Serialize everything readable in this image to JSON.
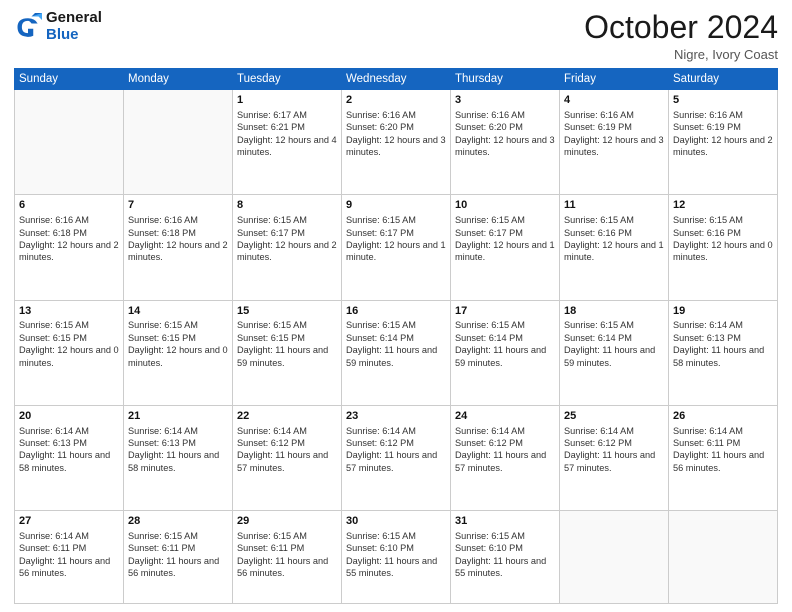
{
  "logo": {
    "line1": "General",
    "line2": "Blue"
  },
  "title": "October 2024",
  "subtitle": "Nigre, Ivory Coast",
  "days_header": [
    "Sunday",
    "Monday",
    "Tuesday",
    "Wednesday",
    "Thursday",
    "Friday",
    "Saturday"
  ],
  "weeks": [
    [
      {
        "num": "",
        "info": ""
      },
      {
        "num": "",
        "info": ""
      },
      {
        "num": "1",
        "info": "Sunrise: 6:17 AM\nSunset: 6:21 PM\nDaylight: 12 hours and 4 minutes."
      },
      {
        "num": "2",
        "info": "Sunrise: 6:16 AM\nSunset: 6:20 PM\nDaylight: 12 hours and 3 minutes."
      },
      {
        "num": "3",
        "info": "Sunrise: 6:16 AM\nSunset: 6:20 PM\nDaylight: 12 hours and 3 minutes."
      },
      {
        "num": "4",
        "info": "Sunrise: 6:16 AM\nSunset: 6:19 PM\nDaylight: 12 hours and 3 minutes."
      },
      {
        "num": "5",
        "info": "Sunrise: 6:16 AM\nSunset: 6:19 PM\nDaylight: 12 hours and 2 minutes."
      }
    ],
    [
      {
        "num": "6",
        "info": "Sunrise: 6:16 AM\nSunset: 6:18 PM\nDaylight: 12 hours and 2 minutes."
      },
      {
        "num": "7",
        "info": "Sunrise: 6:16 AM\nSunset: 6:18 PM\nDaylight: 12 hours and 2 minutes."
      },
      {
        "num": "8",
        "info": "Sunrise: 6:15 AM\nSunset: 6:17 PM\nDaylight: 12 hours and 2 minutes."
      },
      {
        "num": "9",
        "info": "Sunrise: 6:15 AM\nSunset: 6:17 PM\nDaylight: 12 hours and 1 minute."
      },
      {
        "num": "10",
        "info": "Sunrise: 6:15 AM\nSunset: 6:17 PM\nDaylight: 12 hours and 1 minute."
      },
      {
        "num": "11",
        "info": "Sunrise: 6:15 AM\nSunset: 6:16 PM\nDaylight: 12 hours and 1 minute."
      },
      {
        "num": "12",
        "info": "Sunrise: 6:15 AM\nSunset: 6:16 PM\nDaylight: 12 hours and 0 minutes."
      }
    ],
    [
      {
        "num": "13",
        "info": "Sunrise: 6:15 AM\nSunset: 6:15 PM\nDaylight: 12 hours and 0 minutes."
      },
      {
        "num": "14",
        "info": "Sunrise: 6:15 AM\nSunset: 6:15 PM\nDaylight: 12 hours and 0 minutes."
      },
      {
        "num": "15",
        "info": "Sunrise: 6:15 AM\nSunset: 6:15 PM\nDaylight: 11 hours and 59 minutes."
      },
      {
        "num": "16",
        "info": "Sunrise: 6:15 AM\nSunset: 6:14 PM\nDaylight: 11 hours and 59 minutes."
      },
      {
        "num": "17",
        "info": "Sunrise: 6:15 AM\nSunset: 6:14 PM\nDaylight: 11 hours and 59 minutes."
      },
      {
        "num": "18",
        "info": "Sunrise: 6:15 AM\nSunset: 6:14 PM\nDaylight: 11 hours and 59 minutes."
      },
      {
        "num": "19",
        "info": "Sunrise: 6:14 AM\nSunset: 6:13 PM\nDaylight: 11 hours and 58 minutes."
      }
    ],
    [
      {
        "num": "20",
        "info": "Sunrise: 6:14 AM\nSunset: 6:13 PM\nDaylight: 11 hours and 58 minutes."
      },
      {
        "num": "21",
        "info": "Sunrise: 6:14 AM\nSunset: 6:13 PM\nDaylight: 11 hours and 58 minutes."
      },
      {
        "num": "22",
        "info": "Sunrise: 6:14 AM\nSunset: 6:12 PM\nDaylight: 11 hours and 57 minutes."
      },
      {
        "num": "23",
        "info": "Sunrise: 6:14 AM\nSunset: 6:12 PM\nDaylight: 11 hours and 57 minutes."
      },
      {
        "num": "24",
        "info": "Sunrise: 6:14 AM\nSunset: 6:12 PM\nDaylight: 11 hours and 57 minutes."
      },
      {
        "num": "25",
        "info": "Sunrise: 6:14 AM\nSunset: 6:12 PM\nDaylight: 11 hours and 57 minutes."
      },
      {
        "num": "26",
        "info": "Sunrise: 6:14 AM\nSunset: 6:11 PM\nDaylight: 11 hours and 56 minutes."
      }
    ],
    [
      {
        "num": "27",
        "info": "Sunrise: 6:14 AM\nSunset: 6:11 PM\nDaylight: 11 hours and 56 minutes."
      },
      {
        "num": "28",
        "info": "Sunrise: 6:15 AM\nSunset: 6:11 PM\nDaylight: 11 hours and 56 minutes."
      },
      {
        "num": "29",
        "info": "Sunrise: 6:15 AM\nSunset: 6:11 PM\nDaylight: 11 hours and 56 minutes."
      },
      {
        "num": "30",
        "info": "Sunrise: 6:15 AM\nSunset: 6:10 PM\nDaylight: 11 hours and 55 minutes."
      },
      {
        "num": "31",
        "info": "Sunrise: 6:15 AM\nSunset: 6:10 PM\nDaylight: 11 hours and 55 minutes."
      },
      {
        "num": "",
        "info": ""
      },
      {
        "num": "",
        "info": ""
      }
    ]
  ]
}
